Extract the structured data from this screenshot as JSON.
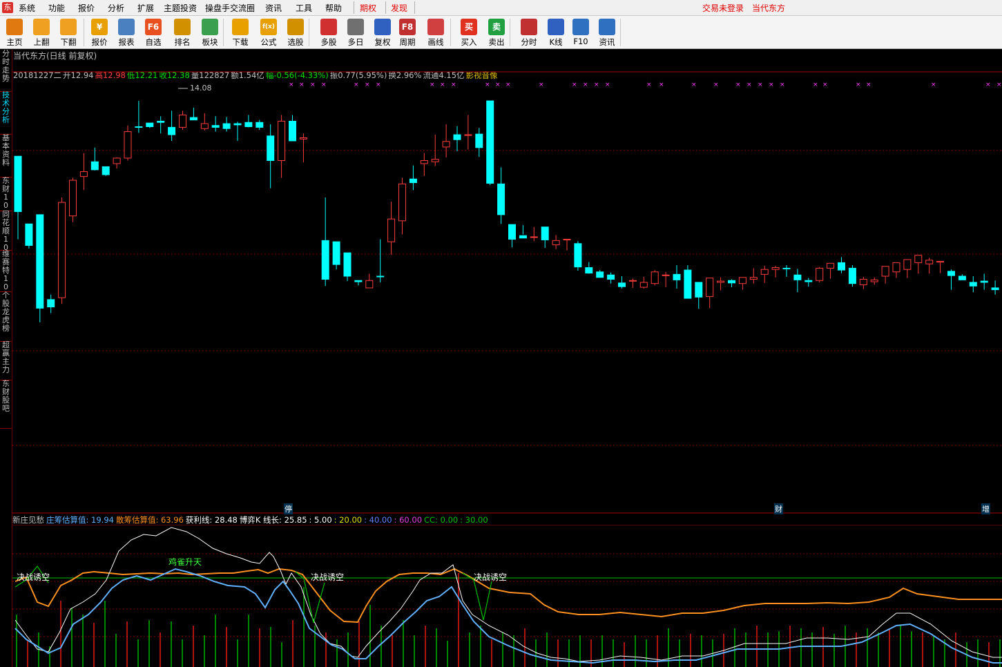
{
  "menu": {
    "items": [
      "系统",
      "功能",
      "报价",
      "分析",
      "扩展",
      "主题投资",
      "操盘手交流圈",
      "资讯",
      "工具",
      "帮助"
    ],
    "red_items": [
      "期权",
      "发现"
    ],
    "login": "交易未登录",
    "stock_name": "当代东方"
  },
  "toolbar": {
    "buttons": [
      {
        "label": "主页",
        "icon": "home-icon",
        "color": "#e07a10"
      },
      {
        "label": "上翻",
        "icon": "arrow-up-icon",
        "color": "#f0a020"
      },
      {
        "label": "下翻",
        "icon": "arrow-down-icon",
        "color": "#f0a020"
      },
      {
        "label": "报价",
        "icon": "yen-icon",
        "color": "#e8a000"
      },
      {
        "label": "报表",
        "icon": "report-icon",
        "color": "#4a7fc0"
      },
      {
        "label": "自选",
        "icon": "f6-icon",
        "color": "#e85020"
      },
      {
        "label": "排名",
        "icon": "rank-icon",
        "color": "#d09000"
      },
      {
        "label": "板块",
        "icon": "block-icon",
        "color": "#3aa050"
      },
      {
        "label": "下载",
        "icon": "download-icon",
        "color": "#e8a000"
      },
      {
        "label": "公式",
        "icon": "formula-icon",
        "color": "#e8a000"
      },
      {
        "label": "选股",
        "icon": "select-stock-icon",
        "color": "#d09000"
      },
      {
        "label": "多股",
        "icon": "multi-stock-icon",
        "color": "#d03030"
      },
      {
        "label": "多日",
        "icon": "multi-day-icon",
        "color": "#707070"
      },
      {
        "label": "复权",
        "icon": "restore-icon",
        "color": "#3060c0"
      },
      {
        "label": "周期",
        "icon": "f8-icon",
        "color": "#c03030"
      },
      {
        "label": "画线",
        "icon": "draw-line-icon",
        "color": "#d04040"
      },
      {
        "label": "买入",
        "icon": "buy-icon",
        "color": "#e03020"
      },
      {
        "label": "卖出",
        "icon": "sell-icon",
        "color": "#20a040"
      },
      {
        "label": "分时",
        "icon": "timeshare-icon",
        "color": "#c03030"
      },
      {
        "label": "K线",
        "icon": "kline-icon",
        "color": "#3060c0"
      },
      {
        "label": "F10",
        "icon": "f10-icon",
        "color": "#3070c0"
      },
      {
        "label": "资讯",
        "icon": "news-icon",
        "color": "#3070c0"
      }
    ],
    "glyphs": {
      "自选": "F6",
      "周期": "F8",
      "买入": "买",
      "卖出": "卖",
      "报价": "¥",
      "公式": "f(x)"
    }
  },
  "sidetabs": [
    {
      "label": "分时走势",
      "active": false
    },
    {
      "label": "技术分析",
      "active": true
    },
    {
      "label": "基本资料",
      "active": false
    },
    {
      "label": "东财10",
      "active": false
    },
    {
      "label": "同花顺10",
      "active": false
    },
    {
      "label": "维赛特10",
      "active": false
    },
    {
      "label": "个股龙虎榜",
      "active": false
    },
    {
      "label": "超赢主力",
      "active": false
    },
    {
      "label": "东财股吧",
      "active": false
    }
  ],
  "chart": {
    "title": "当代东方(日线 前复权)",
    "quote": [
      {
        "text": "20181227二",
        "color": "#c0c0c0"
      },
      {
        "text": "开12.94",
        "color": "#c0c0c0"
      },
      {
        "text": "高12.98",
        "color": "#ff4040"
      },
      {
        "text": "低12.21",
        "color": "#00e000"
      },
      {
        "text": "收12.38",
        "color": "#00e000"
      },
      {
        "text": "量122827",
        "color": "#c0c0c0"
      },
      {
        "text": "额1.54亿",
        "color": "#c0c0c0"
      },
      {
        "text": "幅-0.56(-4.33%)",
        "color": "#00e000"
      },
      {
        "text": "振0.77(5.95%)",
        "color": "#c0c0c0"
      },
      {
        "text": "换2.96%",
        "color": "#c0c0c0"
      },
      {
        "text": "流通4.15亿",
        "color": "#c0c0c0"
      },
      {
        "text": "影视音像",
        "color": "#e0c000"
      }
    ],
    "max_label": "14.08",
    "markers": [
      "停",
      "财",
      "增"
    ]
  },
  "indicator": {
    "name": "新庄见愁",
    "values": [
      {
        "text": "庄筹估算值: 19.94",
        "color": "#60b0ff"
      },
      {
        "text": "散筹估算值: 63.96",
        "color": "#ff9020"
      },
      {
        "text": "获利线: 28.48",
        "color": "#ffffff"
      },
      {
        "text": "博弈K 线长: 25.85",
        "color": "#ffffff"
      },
      {
        "text": ": 5.00",
        "color": "#ffffff"
      },
      {
        "text": ": 20.00",
        "color": "#e0e000"
      },
      {
        "text": ": 40.00",
        "color": "#6080ff"
      },
      {
        "text": ": 60.00",
        "color": "#e040e0"
      },
      {
        "text": "CC: 0.00",
        "color": "#00c000"
      },
      {
        "text": ": 30.00",
        "color": "#00c000"
      }
    ],
    "labels": [
      {
        "text": "决战诱空",
        "color": "#ffffff"
      },
      {
        "text": "鸡雀升天",
        "color": "#40ff40"
      },
      {
        "text": "决战诱空",
        "color": "#ffffff"
      },
      {
        "text": "决战诱空",
        "color": "#ffffff"
      }
    ]
  },
  "chart_data": {
    "type": "candlestick",
    "title": "当代东方(日线 前复权)",
    "candles": [
      [
        13.05,
        13.05,
        11.7,
        12.15
      ],
      [
        11.95,
        11.95,
        11.55,
        11.6
      ],
      [
        12.1,
        12.1,
        10.35,
        10.58
      ],
      [
        10.72,
        10.8,
        10.5,
        10.6
      ],
      [
        10.75,
        12.38,
        10.65,
        12.3
      ],
      [
        12.08,
        12.7,
        11.98,
        12.66
      ],
      [
        12.72,
        13.1,
        12.5,
        12.8
      ],
      [
        12.96,
        13.19,
        12.82,
        12.83
      ],
      [
        12.88,
        12.88,
        12.73,
        12.75
      ],
      [
        12.93,
        13.03,
        12.85,
        13.02
      ],
      [
        13.02,
        13.55,
        12.98,
        13.45
      ],
      [
        13.53,
        13.95,
        13.43,
        13.52
      ],
      [
        13.59,
        13.59,
        13.51,
        13.53
      ],
      [
        13.62,
        13.7,
        13.42,
        13.6
      ],
      [
        13.52,
        13.79,
        13.3,
        13.4
      ],
      [
        13.52,
        13.79,
        13.48,
        13.72
      ],
      [
        13.68,
        13.84,
        13.64,
        13.64
      ],
      [
        13.5,
        13.75,
        13.47,
        13.58
      ],
      [
        13.55,
        13.7,
        13.45,
        13.52
      ],
      [
        13.58,
        13.69,
        13.45,
        13.5
      ],
      [
        13.58,
        13.61,
        13.3,
        13.56
      ],
      [
        13.6,
        13.72,
        13.52,
        13.53
      ],
      [
        13.6,
        13.64,
        13.48,
        13.52
      ],
      [
        13.38,
        13.57,
        12.53,
        12.98
      ],
      [
        12.98,
        13.72,
        12.7,
        13.62
      ],
      [
        13.62,
        13.72,
        13.3,
        13.3
      ],
      [
        13.33,
        13.42,
        12.95,
        13.35
      ],
      [],
      [
        11.68,
        12.38,
        10.94,
        11.05
      ],
      [
        11.66,
        11.66,
        11.21,
        11.29
      ],
      [
        11.48,
        11.48,
        11.02,
        11.1
      ],
      [
        11.03,
        11.03,
        10.95,
        11.01
      ],
      [
        10.91,
        11.14,
        10.94,
        11.03
      ],
      [
        11.1,
        11.7,
        11.0,
        11.09
      ],
      [
        11.66,
        12.31,
        11.45,
        12.03
      ],
      [
        12.0,
        12.7,
        11.78,
        12.6
      ],
      [
        12.68,
        12.9,
        12.5,
        12.62
      ],
      [
        12.93,
        13.1,
        12.73,
        12.98
      ],
      [
        12.96,
        13.4,
        12.89,
        13.0
      ],
      [
        13.2,
        13.57,
        13.03,
        13.29
      ],
      [
        13.4,
        13.54,
        13.13,
        13.32
      ],
      [
        13.4,
        13.72,
        13.16,
        13.4
      ],
      [
        13.41,
        13.51,
        13.04,
        13.19
      ],
      [
        13.95,
        13.95,
        12.58,
        12.61
      ],
      [
        12.6,
        12.87,
        11.95,
        12.1
      ],
      [
        11.94,
        11.94,
        11.57,
        11.7
      ],
      [
        11.76,
        11.93,
        11.78,
        11.72
      ],
      [
        11.73,
        11.9,
        11.67,
        11.74
      ],
      [
        11.9,
        11.9,
        11.56,
        11.69
      ],
      [
        11.61,
        11.77,
        11.54,
        11.68
      ],
      [
        11.7,
        11.7,
        11.52,
        11.7
      ],
      [
        11.63,
        11.67,
        11.19,
        11.25
      ],
      [
        11.24,
        11.33,
        11.14,
        11.15
      ],
      [
        11.17,
        11.2,
        11.14,
        11.08
      ],
      [
        11.12,
        11.16,
        10.98,
        11.05
      ],
      [
        10.99,
        11.1,
        10.9,
        10.93
      ],
      [
        11.02,
        11.06,
        10.91,
        11.03
      ],
      [
        10.92,
        11.09,
        10.9,
        11.0
      ],
      [
        10.98,
        11.2,
        10.95,
        11.17
      ],
      [
        11.12,
        11.17,
        10.92,
        11.12
      ],
      [
        11.13,
        11.28,
        10.9,
        11.04
      ],
      [
        11.2,
        11.28,
        10.82,
        10.74
      ],
      [
        11.0,
        11.0,
        10.57,
        10.76
      ],
      [
        10.77,
        11.05,
        10.58,
        11.07
      ],
      [
        11.0,
        11.08,
        10.87,
        11.02
      ],
      [
        11.03,
        11.05,
        10.92,
        10.99
      ],
      [
        10.98,
        11.02,
        10.88,
        11.08
      ],
      [
        11.05,
        11.23,
        10.98,
        11.08
      ],
      [
        11.13,
        11.27,
        10.99,
        11.21
      ],
      [
        11.21,
        11.27,
        11.08,
        11.24
      ],
      [
        11.23,
        11.28,
        11.09,
        11.22
      ],
      [
        11.12,
        11.22,
        10.84,
        11.04
      ],
      [
        11.03,
        11.07,
        10.93,
        11.01
      ],
      [
        11.03,
        11.25,
        11.0,
        11.23
      ],
      [
        11.23,
        11.28,
        11.06,
        11.31
      ],
      [
        11.32,
        11.41,
        11.15,
        11.2
      ],
      [
        11.23,
        11.28,
        10.93,
        10.98
      ],
      [
        10.96,
        11.09,
        10.89,
        11.05
      ],
      [
        11.01,
        11.08,
        10.96,
        11.04
      ],
      [
        11.1,
        11.21,
        10.98,
        11.26
      ],
      [
        11.17,
        11.32,
        11.07,
        11.32
      ],
      [
        11.21,
        11.33,
        11.07,
        11.37
      ],
      [
        11.32,
        11.38,
        11.14,
        11.44
      ],
      [
        11.3,
        11.4,
        11.14,
        11.36
      ],
      [
        11.33,
        11.32,
        11.15,
        11.34
      ],
      [
        11.18,
        11.21,
        10.88,
        11.11
      ],
      [
        11.1,
        11.13,
        11.04,
        11.04
      ],
      [
        11.0,
        11.1,
        10.84,
        10.94
      ],
      [
        11.02,
        11.14,
        10.88,
        11.0
      ],
      [
        10.91,
        11.03,
        10.8,
        10.88
      ],
      [
        10.86,
        11.05,
        10.67,
        10.86
      ],
      [
        10.86,
        10.99,
        10.63,
        10.71
      ]
    ],
    "notes": "Daily K-line chart; red = up (hollow), cyan = down (filled). Last bar: 开12.94 高12.98 低12.21 收12.38 (rightmost bar shown near price ~11.5 on chart scale of partial window).",
    "indicator_series": {
      "name": "新庄见愁",
      "series": [
        {
          "name": "庄筹估算值",
          "color": "#60b0ff",
          "last": 19.94
        },
        {
          "name": "散筹估算值",
          "color": "#ff9020",
          "last": 63.96
        },
        {
          "name": "获利线",
          "color": "#ffffff",
          "last": 28.48
        }
      ],
      "reference_lines": [
        5,
        20,
        40,
        60,
        30
      ]
    }
  }
}
